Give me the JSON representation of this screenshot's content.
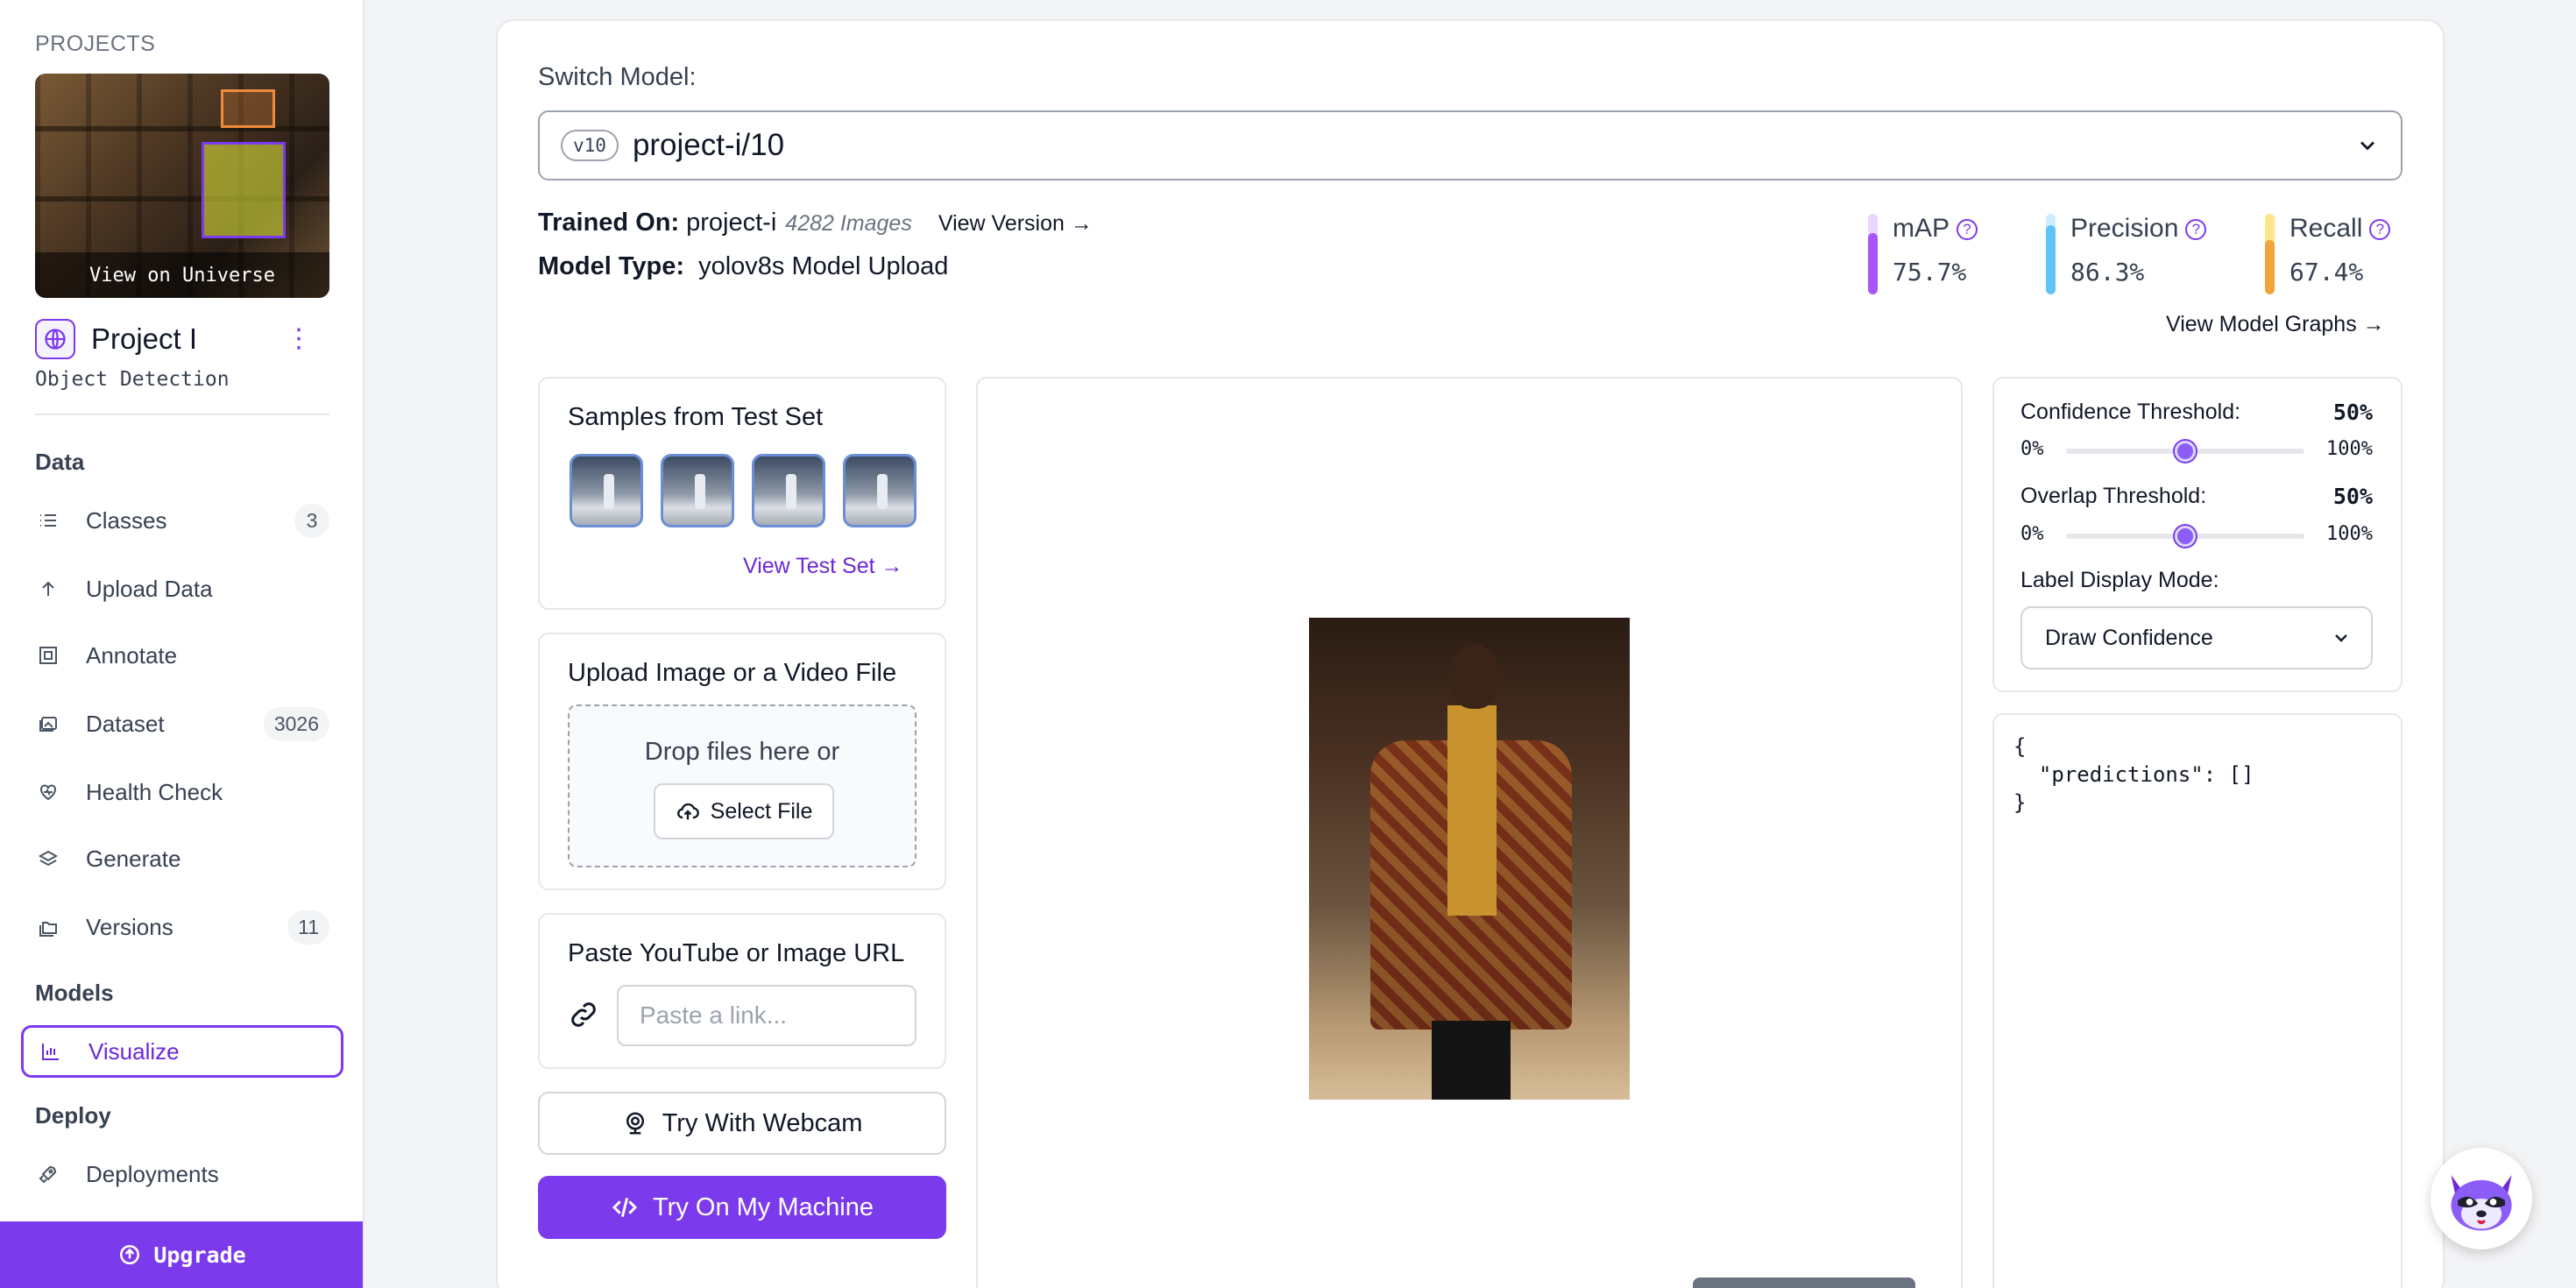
{
  "sidebar": {
    "projects_heading": "PROJECTS",
    "thumbnail_caption": "View on Universe",
    "project_name": "Project I",
    "project_type": "Object Detection",
    "sections": {
      "data": "Data",
      "models": "Models",
      "deploy": "Deploy"
    },
    "items": [
      {
        "label": "Classes",
        "count": "3",
        "icon": "list-icon"
      },
      {
        "label": "Upload Data",
        "count": "",
        "icon": "arrow-up-icon"
      },
      {
        "label": "Annotate",
        "count": "",
        "icon": "annotate-icon"
      },
      {
        "label": "Dataset",
        "count": "3026",
        "icon": "images-icon"
      },
      {
        "label": "Health Check",
        "count": "",
        "icon": "heart-pulse-icon"
      },
      {
        "label": "Generate",
        "count": "",
        "icon": "layers-icon"
      },
      {
        "label": "Versions",
        "count": "11",
        "icon": "folders-icon"
      },
      {
        "label": "Visualize",
        "count": "",
        "icon": "chart-icon",
        "active": true
      },
      {
        "label": "Deployments",
        "count": "",
        "icon": "rocket-icon"
      }
    ],
    "upgrade_label": "Upgrade"
  },
  "main": {
    "switch_model_label": "Switch Model:",
    "model_version_pill": "v10",
    "model_name": "project-i/10",
    "trained_on_label": "Trained On:",
    "trained_on_value": "project-i",
    "trained_images": "4282 Images",
    "view_version": "View Version",
    "model_type_label": "Model Type:",
    "model_type_value": "yolov8s Model Upload",
    "metrics": [
      {
        "name": "mAP",
        "value": "75.7%",
        "fraction": 0.757,
        "color": "#a855f7",
        "track": "#e9d5ff"
      },
      {
        "name": "Precision",
        "value": "86.3%",
        "fraction": 0.863,
        "color": "#60c3f5",
        "track": "#cdeefe"
      },
      {
        "name": "Recall",
        "value": "67.4%",
        "fraction": 0.674,
        "color": "#f0a43a",
        "track": "#fde68a"
      }
    ],
    "view_model_graphs": "View Model Graphs"
  },
  "samples": {
    "title": "Samples from Test Set",
    "view_test_set": "View Test Set"
  },
  "upload": {
    "title": "Upload Image or a Video File",
    "drop_text": "Drop files here or",
    "select_file": "Select File"
  },
  "paste": {
    "title": "Paste YouTube or Image URL",
    "placeholder": "Paste a link..."
  },
  "buttons": {
    "webcam": "Try With Webcam",
    "machine": "Try On My Machine"
  },
  "settings": {
    "confidence_label": "Confidence Threshold:",
    "confidence_value": "50%",
    "confidence_fraction": 0.5,
    "overlap_label": "Overlap Threshold:",
    "overlap_value": "50%",
    "overlap_fraction": 0.5,
    "range_min": "0%",
    "range_max": "100%",
    "label_mode_label": "Label Display Mode:",
    "label_mode_value": "Draw Confidence"
  },
  "output": {
    "json_text": "{\n  \"predictions\": []\n}"
  },
  "colors": {
    "accent": "#7c3aed"
  }
}
